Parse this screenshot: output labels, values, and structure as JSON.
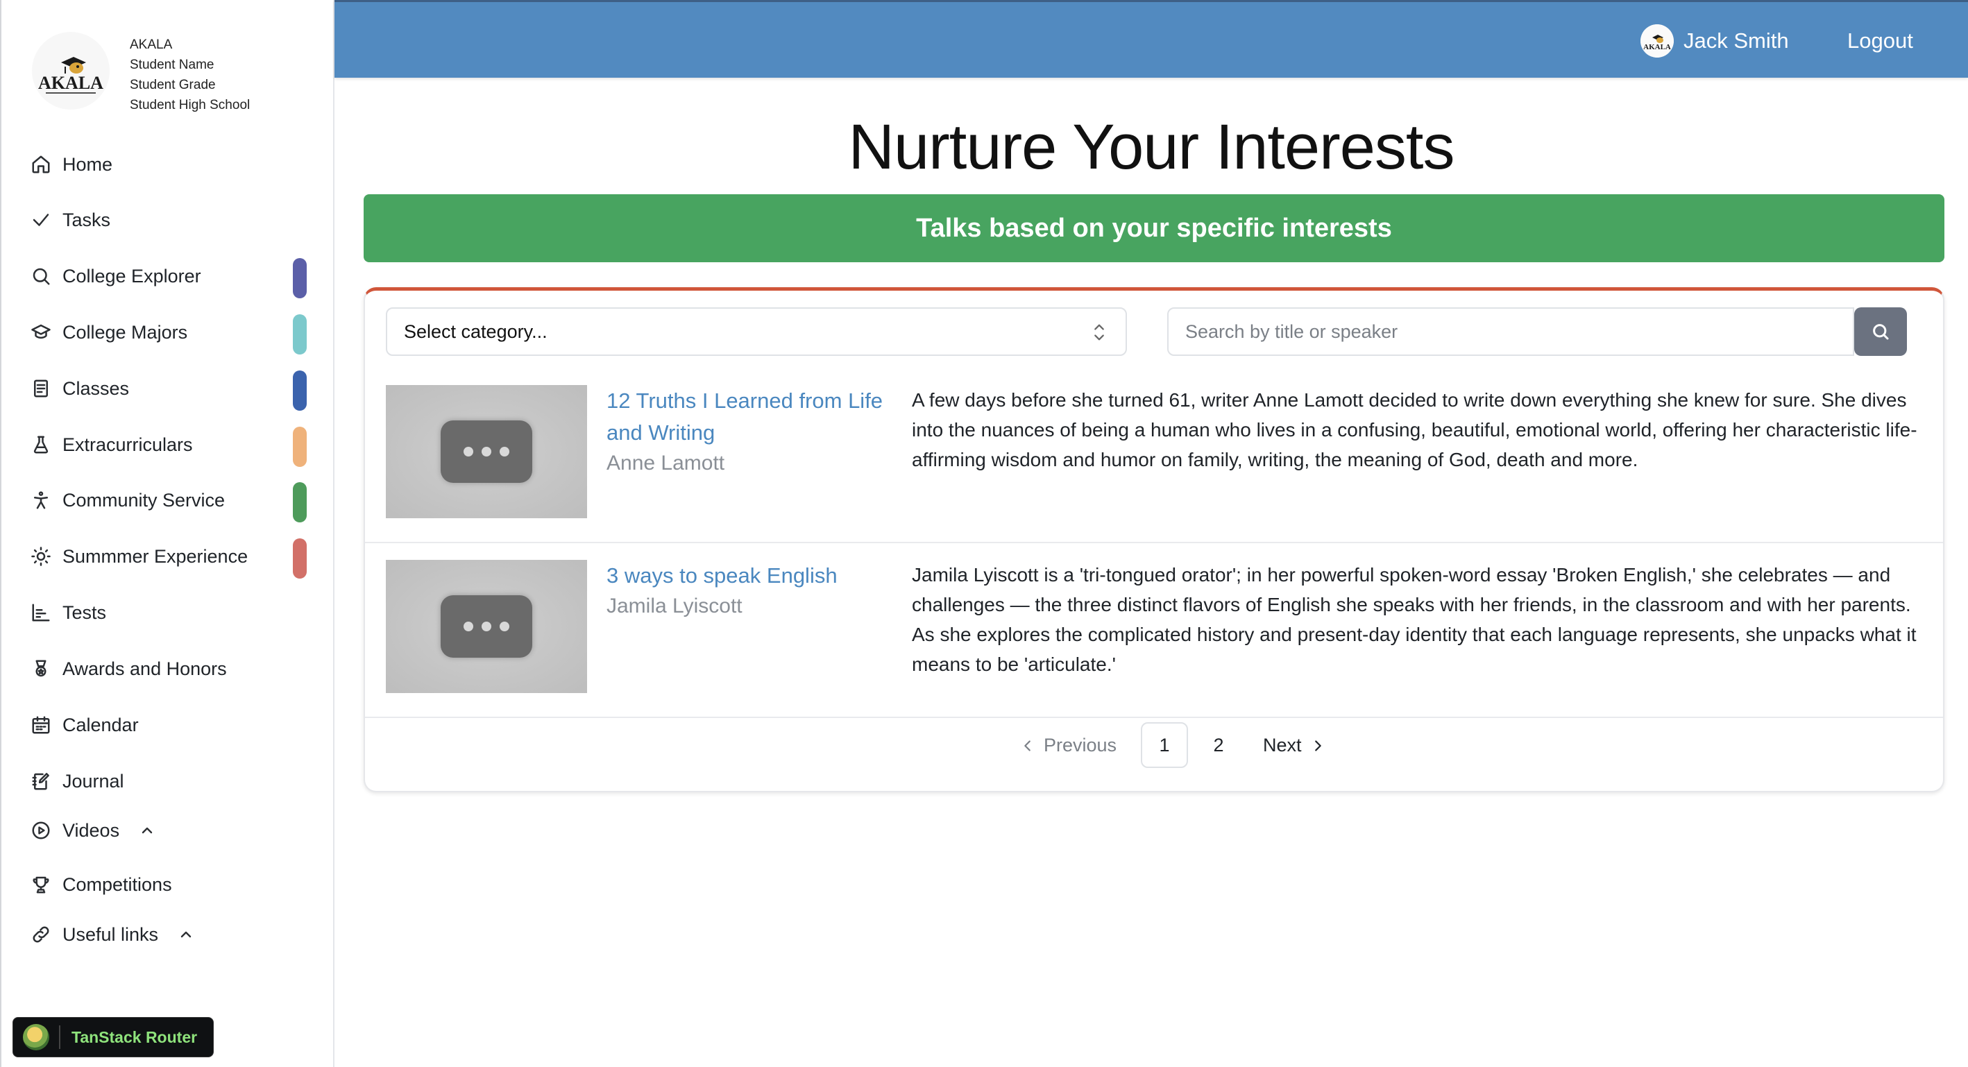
{
  "brand": {
    "logo_text": "AKALA",
    "meta": [
      "AKALA",
      "Student Name",
      "Student Grade",
      "Student High School"
    ]
  },
  "sidebar": {
    "items": [
      {
        "label": "Home",
        "icon": "home-icon"
      },
      {
        "label": "Tasks",
        "icon": "check-icon"
      },
      {
        "label": "College Explorer",
        "icon": "search-icon",
        "accent": "#5b5fa8"
      },
      {
        "label": "College Majors",
        "icon": "graduation-cap-icon",
        "accent": "#7cc9cc"
      },
      {
        "label": "Classes",
        "icon": "notebook-icon",
        "accent": "#3b63ad"
      },
      {
        "label": "Extracurriculars",
        "icon": "flask-icon",
        "accent": "#efb27b"
      },
      {
        "label": "Community Service",
        "icon": "accessibility-icon",
        "accent": "#4e9b5b"
      },
      {
        "label": "Summmer Experience",
        "icon": "sun-icon",
        "accent": "#d27068"
      },
      {
        "label": "Tests",
        "icon": "chart-icon"
      },
      {
        "label": "Awards and Honors",
        "icon": "award-icon"
      },
      {
        "label": "Calendar",
        "icon": "calendar-icon"
      },
      {
        "label": "Journal",
        "icon": "journal-icon"
      },
      {
        "label": "Videos",
        "icon": "play-icon",
        "expandable": true
      },
      {
        "label": "Competitions",
        "icon": "trophy-icon"
      },
      {
        "label": "Useful links",
        "icon": "link-icon",
        "expandable": true
      }
    ]
  },
  "devtools": {
    "label": "TanStack Router"
  },
  "topbar": {
    "user_name": "Jack Smith",
    "logout_label": "Logout",
    "bg_color": "#528ac0"
  },
  "main": {
    "title": "Nurture Your Interests",
    "banner": "Talks based on your specific interests",
    "banner_color": "#48a460",
    "category_select": {
      "selected": "Select category..."
    },
    "search": {
      "placeholder": "Search by title or speaker"
    },
    "talks": [
      {
        "title": "12 Truths I Learned from Life and Writing",
        "speaker": "Anne Lamott",
        "description": "A few days before she turned 61, writer Anne Lamott decided to write down everything she knew for sure. She dives into the nuances of being a human who lives in a confusing, beautiful, emotional world, offering her characteristic life-affirming wisdom and humor on family, writing, the meaning of God, death and more."
      },
      {
        "title": "3 ways to speak English",
        "speaker": "Jamila Lyiscott",
        "description": "Jamila Lyiscott is a 'tri-tongued orator'; in her powerful spoken-word essay 'Broken English,' she celebrates — and challenges — the three distinct flavors of English she speaks with her friends, in the classroom and with her parents. As she explores the complicated history and present-day identity that each language represents, she unpacks what it means to be 'articulate.'"
      }
    ],
    "pagination": {
      "previous_label": "Previous",
      "pages": [
        "1",
        "2"
      ],
      "current_page": "1",
      "next_label": "Next"
    }
  }
}
